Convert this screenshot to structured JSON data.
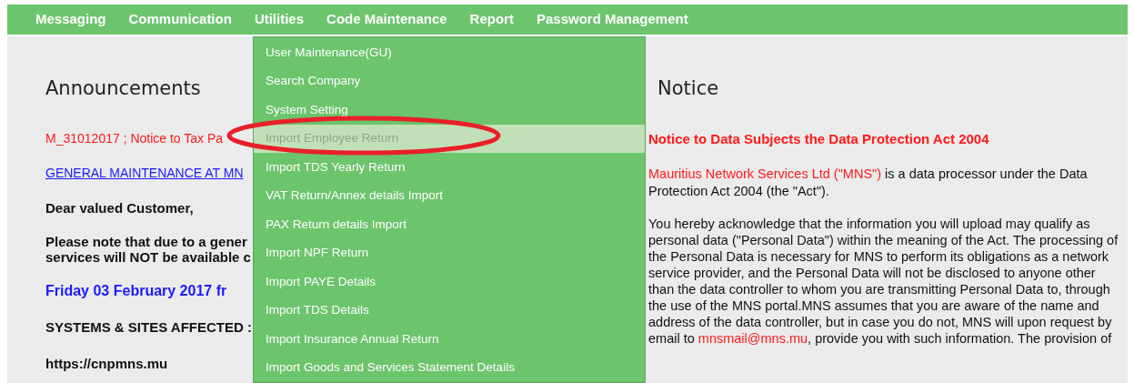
{
  "nav": {
    "items": [
      {
        "label": "Messaging"
      },
      {
        "label": "Communication"
      },
      {
        "label": "Utilities"
      },
      {
        "label": "Code Maintenance"
      },
      {
        "label": "Report"
      },
      {
        "label": "Password Management"
      }
    ]
  },
  "dropdown": {
    "items": [
      {
        "label": "User Maintenance(GU)",
        "selected": false
      },
      {
        "label": "Search Company",
        "selected": false
      },
      {
        "label": "System Setting",
        "selected": false
      },
      {
        "label": "Import Employee Return",
        "selected": true
      },
      {
        "label": "Import TDS Yearly Return",
        "selected": false
      },
      {
        "label": "VAT Return/Annex details Import",
        "selected": false
      },
      {
        "label": "PAX Return details Import",
        "selected": false
      },
      {
        "label": "Import NPF Return",
        "selected": false
      },
      {
        "label": "Import PAYE Details",
        "selected": false
      },
      {
        "label": "Import TDS Details",
        "selected": false
      },
      {
        "label": "Import Insurance Annual Return",
        "selected": false
      },
      {
        "label": "Import Goods and Services Statement Details",
        "selected": false
      }
    ]
  },
  "announcements": {
    "title": "Announcements",
    "items": [
      {
        "kind": "notice",
        "text": "M_31012017 ; Notice to Tax Pa"
      },
      {
        "kind": "link",
        "text": "GENERAL MAINTENANCE AT MN"
      },
      {
        "kind": "bold",
        "text": "Dear valued Customer,"
      },
      {
        "kind": "bold2",
        "lines": [
          "Please note that due to a gener",
          "services will NOT be available c"
        ]
      },
      {
        "kind": "date",
        "text": "Friday 03 February 2017 fr"
      },
      {
        "kind": "bold",
        "text": "SYSTEMS & SITES AFFECTED :"
      },
      {
        "kind": "bold",
        "text": "https://cnpmns.mu"
      }
    ]
  },
  "notice": {
    "title": "Notice",
    "subtitle": "Notice to Data Subjects the Data Protection Act 2004",
    "intro": {
      "org": "Mauritius Network Services Ltd (\"MNS\")",
      "text": " is a data processor under the Data Protection Act 2004 (the \"Act\")."
    },
    "body": "You hereby acknowledge that the information you will upload may qualify as personal data (\"Personal Data\") within the meaning of the Act. The processing of the Personal Data is necessary for MNS to perform its obligations as a network service provider, and the Personal Data will not be disclosed to anyone other than the data controller to whom you are transmitting Personal Data to, through the use of the MNS portal.MNS assumes that you are aware of the name and address of the data controller, but in case you do not, MNS will upon request by email to",
    "email": "mnsmail@mns.mu",
    "tail": ", provide you with such information. The provision of"
  }
}
